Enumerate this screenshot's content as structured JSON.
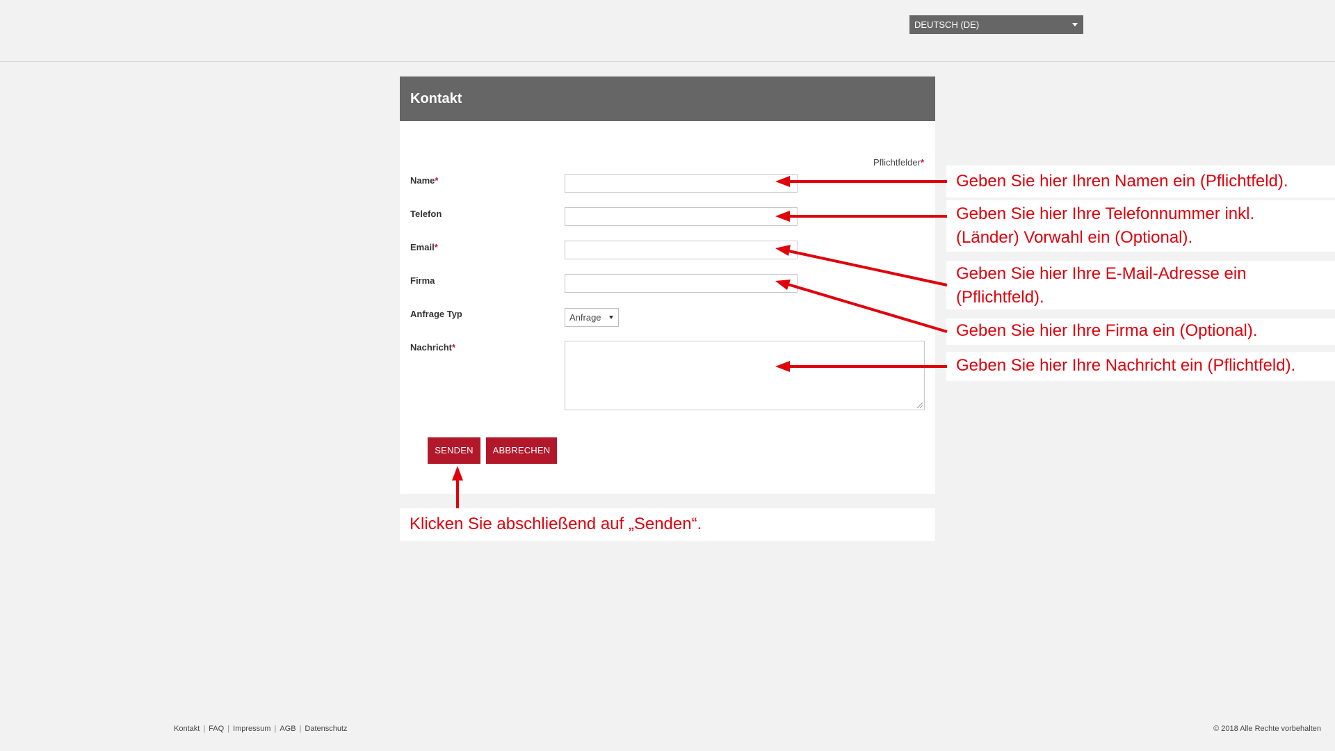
{
  "header": {
    "language": "DEUTSCH (DE)"
  },
  "form": {
    "title": "Kontakt",
    "required_note": "Pflichtfelder",
    "required_marker": "*",
    "fields": {
      "name": {
        "label": "Name",
        "value": ""
      },
      "telefon": {
        "label": "Telefon",
        "value": ""
      },
      "email": {
        "label": "Email",
        "value": ""
      },
      "firma": {
        "label": "Firma",
        "value": ""
      },
      "anfrage_typ": {
        "label": "Anfrage Typ",
        "value": "Anfrage"
      },
      "nachricht": {
        "label": "Nachricht",
        "value": ""
      }
    },
    "buttons": {
      "send": "SENDEN",
      "cancel": "ABBRECHEN"
    }
  },
  "annotations": {
    "name": "Geben Sie hier Ihren Namen ein (Pflichtfeld).",
    "telefon_1": "Geben Sie hier Ihre Telefonnummer inkl.",
    "telefon_2": "(Länder) Vorwahl ein (Optional).",
    "email_1": "Geben Sie hier Ihre E-Mail-Adresse ein",
    "email_2": "(Pflichtfeld).",
    "firma": "Geben Sie hier Ihre Firma ein (Optional).",
    "nachricht": "Geben Sie hier Ihre Nachricht ein (Pflichtfeld).",
    "senden": "Klicken Sie abschließend auf „Senden“."
  },
  "footer": {
    "links": [
      "Kontakt",
      "FAQ",
      "Impressum",
      "AGB",
      "Datenschutz"
    ],
    "copyright": "© 2018 Alle Rechte vorbehalten"
  },
  "colors": {
    "header_gray": "#666666",
    "button_red": "#b3172a",
    "annotation_red": "#e0000b"
  }
}
